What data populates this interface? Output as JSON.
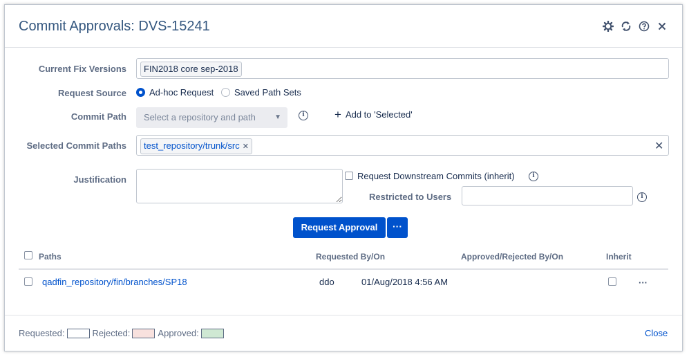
{
  "dialog": {
    "title": "Commit Approvals: DVS-15241",
    "header_icons": [
      "gear-icon",
      "refresh-icon",
      "help-icon",
      "close-icon"
    ]
  },
  "form": {
    "fix_versions": {
      "label": "Current Fix Versions",
      "tags": [
        "FIN2018 core sep-2018"
      ]
    },
    "request_source": {
      "label": "Request Source",
      "options": [
        "Ad-hoc Request",
        "Saved Path Sets"
      ],
      "selected": "Ad-hoc Request"
    },
    "commit_path": {
      "label": "Commit Path",
      "placeholder": "Select a repository and path",
      "add_label": "Add to 'Selected'"
    },
    "selected_paths": {
      "label": "Selected Commit Paths",
      "tags": [
        "test_repository/trunk/src"
      ]
    },
    "justification": {
      "label": "Justification",
      "value": ""
    },
    "downstream": {
      "label": "Request Downstream Commits (inherit)",
      "checked": false
    },
    "restricted": {
      "label": "Restricted to Users",
      "value": ""
    }
  },
  "actions": {
    "request_approval": "Request Approval",
    "more": "···"
  },
  "table": {
    "headers": {
      "paths": "Paths",
      "requested": "Requested By/On",
      "approved": "Approved/Rejected By/On",
      "inherit": "Inherit"
    },
    "rows": [
      {
        "path": "qadfin_repository/fin/branches/SP18",
        "requested_by": "ddo",
        "requested_on": "01/Aug/2018 4:56 AM",
        "approved": "",
        "inherit": false,
        "menu": "···"
      }
    ]
  },
  "legend": {
    "requested": {
      "label": "Requested:",
      "color": "#ffffff"
    },
    "rejected": {
      "label": "Rejected:",
      "color": "#f8e1de"
    },
    "approved": {
      "label": "Approved:",
      "color": "#cfe8d3"
    }
  },
  "footer": {
    "close": "Close"
  },
  "colors": {
    "accent": "#0052cc",
    "title": "#34577f"
  }
}
